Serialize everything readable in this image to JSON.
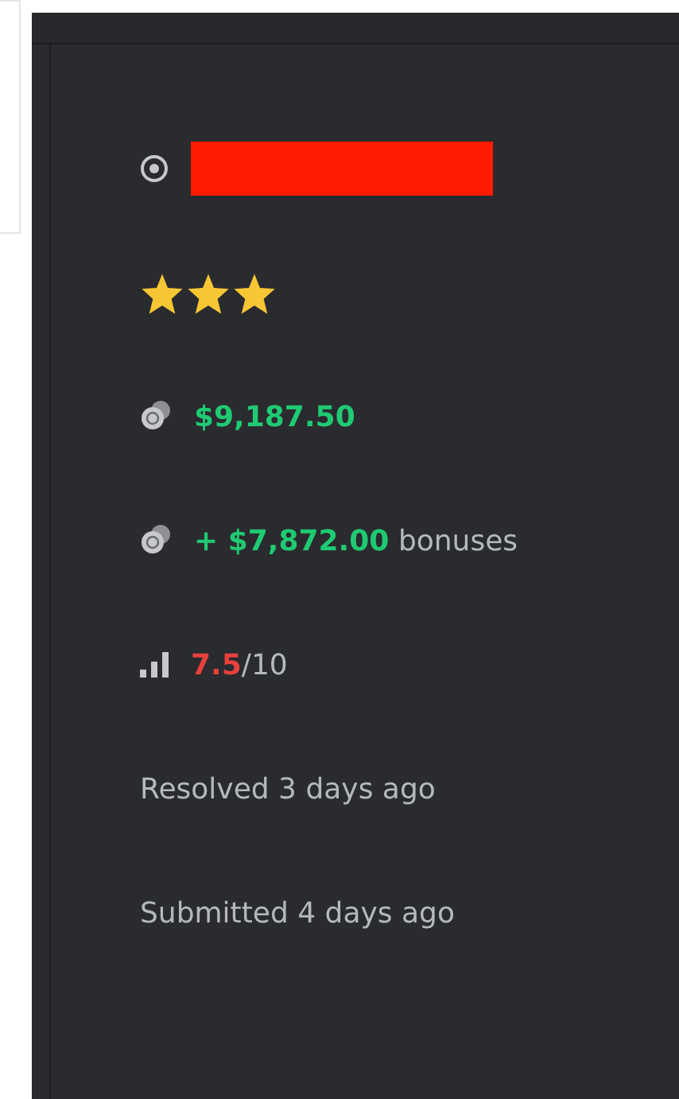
{
  "header": {
    "redacted": true
  },
  "rating": {
    "stars": 3
  },
  "reward": {
    "amount": "$9,187.50"
  },
  "bonus": {
    "amount": "+ $7,872.00",
    "label": "bonuses"
  },
  "score": {
    "value": "7.5",
    "out_of": "/10"
  },
  "resolved": "Resolved 3 days ago",
  "submitted": "Submitted 4 days ago"
}
